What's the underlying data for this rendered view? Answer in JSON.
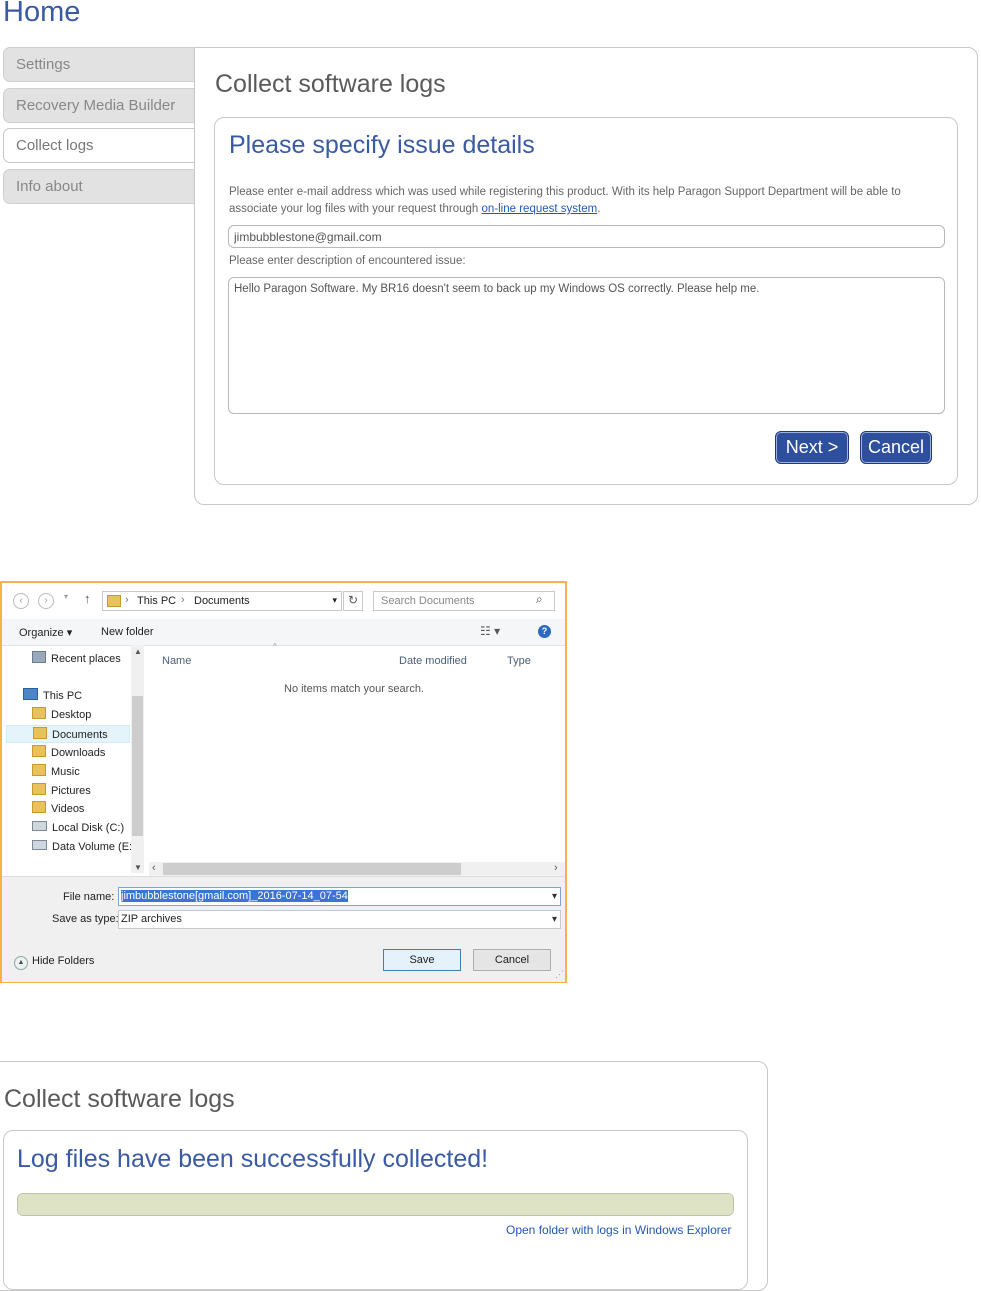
{
  "home": {
    "title": "Home"
  },
  "sidebar": {
    "items": [
      {
        "label": "Settings"
      },
      {
        "label": "Recovery Media Builder"
      },
      {
        "label": "Collect logs"
      },
      {
        "label": "Info about"
      }
    ]
  },
  "collect": {
    "panel_title": "Collect software logs",
    "heading": "Please specify issue details",
    "description_before_link": "Please enter e-mail address which was used while registering this product. With its help Paragon Support Department will be able to associate your log files with your request through ",
    "link_text": "on-line request system",
    "description_after_link": ".",
    "email_value": "jimbubblestone@gmail.com",
    "issue_label": "Please enter description of encountered issue:",
    "issue_value": "Hello Paragon Software. My BR16 doesn't seem to back up my Windows OS correctly. Please help me.",
    "next_label": "Next >",
    "cancel_label": "Cancel"
  },
  "dialog": {
    "breadcrumb": [
      "This PC",
      "Documents"
    ],
    "search_placeholder": "Search Documents",
    "organize_label": "Organize ▾",
    "new_folder_label": "New folder",
    "tree": [
      {
        "label": "Recent places"
      },
      {
        "label": "This PC"
      },
      {
        "label": "Desktop"
      },
      {
        "label": "Documents"
      },
      {
        "label": "Downloads"
      },
      {
        "label": "Music"
      },
      {
        "label": "Pictures"
      },
      {
        "label": "Videos"
      },
      {
        "label": "Local Disk (C:)"
      },
      {
        "label": "Data Volume (E:)"
      }
    ],
    "columns": [
      "Name",
      "Date modified",
      "Type"
    ],
    "empty_message": "No items match your search.",
    "file_name_label": "File name:",
    "file_name_value": "jimbubblestone[gmail.com]_2016-07-14_07-54",
    "save_type_label": "Save as type:",
    "save_type_value": "ZIP archives",
    "hide_folders_label": "Hide Folders",
    "save_label": "Save",
    "cancel_label": "Cancel"
  },
  "result": {
    "panel_title": "Collect software logs",
    "heading": "Log files have been successfully collected!",
    "progress": 1.0,
    "open_folder_link": "Open folder with logs in Windows Explorer"
  },
  "colors": {
    "accent": "#2e4f9e",
    "heading": "#3a5aa3",
    "dialog_border": "#f2b347"
  }
}
